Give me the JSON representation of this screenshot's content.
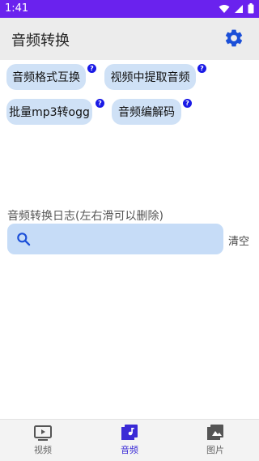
{
  "status_bar": {
    "time": "1:41"
  },
  "app_bar": {
    "title": "音频转换"
  },
  "chips": [
    {
      "label": "音频格式互换",
      "help": "?"
    },
    {
      "label": "视频中提取音频",
      "help": "?"
    },
    {
      "label": "批量mp3转ogg",
      "help": "?"
    },
    {
      "label": "音频编解码",
      "help": "?"
    }
  ],
  "log": {
    "label": "音频转换日志(左右滑可以删除)",
    "search_placeholder": "",
    "search_value": "",
    "clear_label": "清空"
  },
  "bottom_nav": {
    "items": [
      {
        "label": "视频",
        "icon": "video-icon"
      },
      {
        "label": "音频",
        "icon": "music-icon"
      },
      {
        "label": "图片",
        "icon": "image-icon"
      }
    ],
    "active_index": 1
  },
  "colors": {
    "status_bar": "#6a22ee",
    "app_bar": "#ececec",
    "chip": "#cfe1f6",
    "help_badge": "#1a1ae6",
    "search_box": "#c6dcf7",
    "accent": "#3a2ad6"
  }
}
